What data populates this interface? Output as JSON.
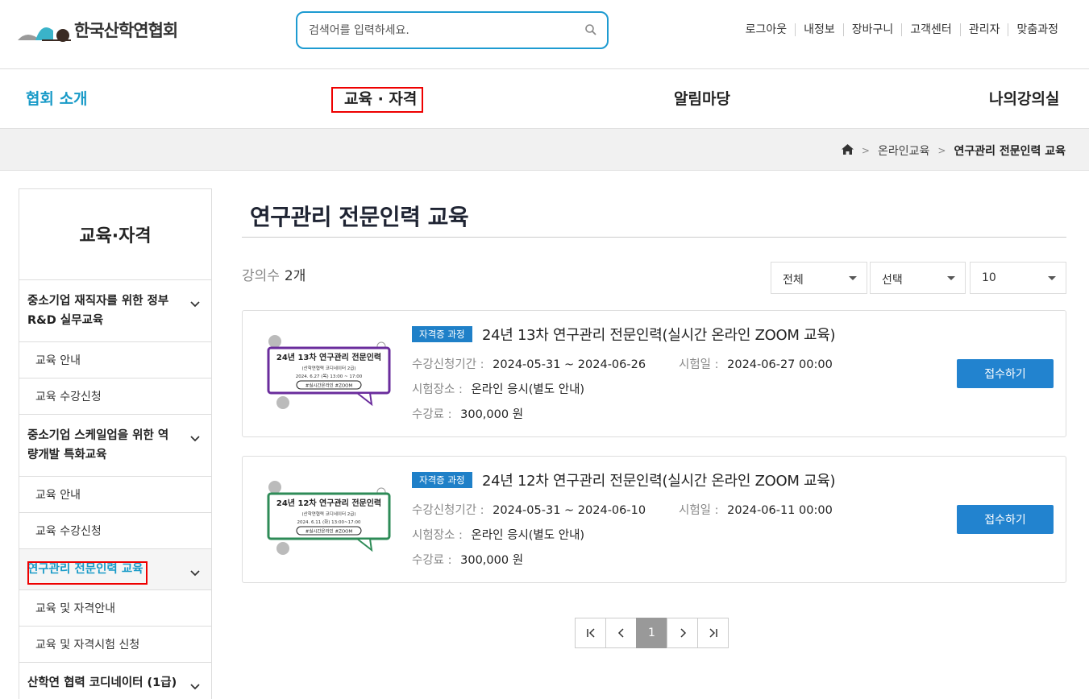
{
  "header": {
    "logo_text": "한국산학연협회",
    "search_placeholder": "검색어를 입력하세요.",
    "util_links": [
      "로그아웃",
      "내정보",
      "장바구니",
      "고객센터",
      "관리자",
      "맞춤과정"
    ]
  },
  "gnb": {
    "items": [
      "협회 소개",
      "교육 · 자격",
      "알림마당",
      "나의강의실"
    ]
  },
  "breadcrumb": {
    "items": [
      "온라인교육",
      "연구관리 전문인력 교육"
    ]
  },
  "sidebar": {
    "title": "교육·자격",
    "groups": [
      {
        "label": "중소기업 재직자를 위한 정부 R&D 실무교육",
        "subs": [
          "교육 안내",
          "교육 수강신청"
        ]
      },
      {
        "label": "중소기업 스케일업을 위한 역량개발 특화교육",
        "subs": [
          "교육 안내",
          "교육 수강신청"
        ]
      },
      {
        "label": "연구관리 전문인력 교육",
        "subs": [
          "교육 및 자격안내",
          "교육 및 자격시험 신청"
        ]
      },
      {
        "label": "산학연 협력 코디네이터 (1급)",
        "subs": []
      }
    ]
  },
  "main": {
    "title": "연구관리 전문인력 교육",
    "count_label": "강의수",
    "count_value": "2개",
    "filters": [
      "전체",
      "선택",
      "10"
    ],
    "courses": [
      {
        "badge": "자격증 과정",
        "title": "24년 13차 연구관리 전문인력(실시간 온라인 ZOOM 교육)",
        "period_label": "수강신청기간 :",
        "period": "2024-05-31 ~ 2024-06-26",
        "exam_label": "시험일 :",
        "exam_date": "2024-06-27 00:00",
        "place_label": "시험장소 :",
        "place": "온라인 응시(별도 안내)",
        "fee_label": "수강료 :",
        "fee": "300,000 원",
        "apply": "접수하기",
        "thumb_title": "24년 13차 연구관리 전문인력",
        "thumb_sub": "(산학연협력 코디네이터 2급)",
        "thumb_date": "2024. 6.27 (목) 13:00 ~ 17:00",
        "thumb_tag": "#실시간온라인 #ZOOM",
        "thumb_color": "#6a2c9c"
      },
      {
        "badge": "자격증 과정",
        "title": "24년 12차 연구관리 전문인력(실시간 온라인 ZOOM 교육)",
        "period_label": "수강신청기간 :",
        "period": "2024-05-31 ~ 2024-06-10",
        "exam_label": "시험일 :",
        "exam_date": "2024-06-11 00:00",
        "place_label": "시험장소 :",
        "place": "온라인 응시(별도 안내)",
        "fee_label": "수강료 :",
        "fee": "300,000 원",
        "apply": "접수하기",
        "thumb_title": "24년 12차 연구관리 전문인력",
        "thumb_sub": "(산학연협력 코디네이터 2급)",
        "thumb_date": "2024. 6.11 (화) 13:00~17:00",
        "thumb_tag": "#실시간온라인 #ZOOM",
        "thumb_color": "#2e8b57"
      }
    ],
    "pagination": {
      "current": "1"
    }
  }
}
